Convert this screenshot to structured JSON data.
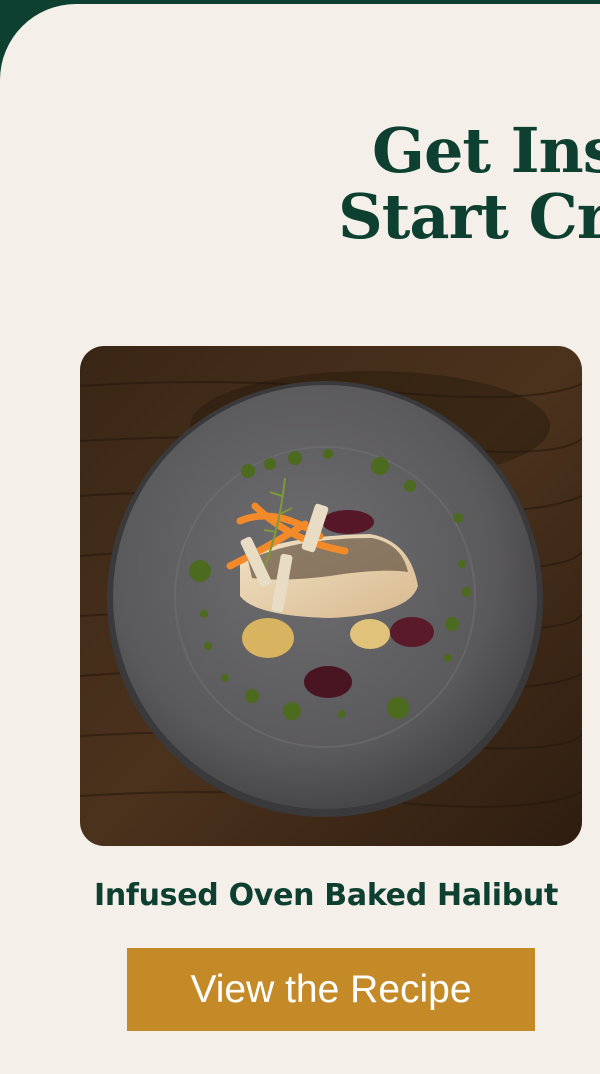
{
  "hero": {
    "headline_line1": "Get Ins",
    "headline_line2": "Start Cr"
  },
  "recipe": {
    "title": "Infused Oven Baked Halibut",
    "image_subject": "plated-halibut-photo",
    "button_label": "View the Recipe"
  },
  "colors": {
    "brand_green": "#0E4032",
    "background_cream": "#F4F0E9",
    "button_gold": "#C58A28"
  }
}
